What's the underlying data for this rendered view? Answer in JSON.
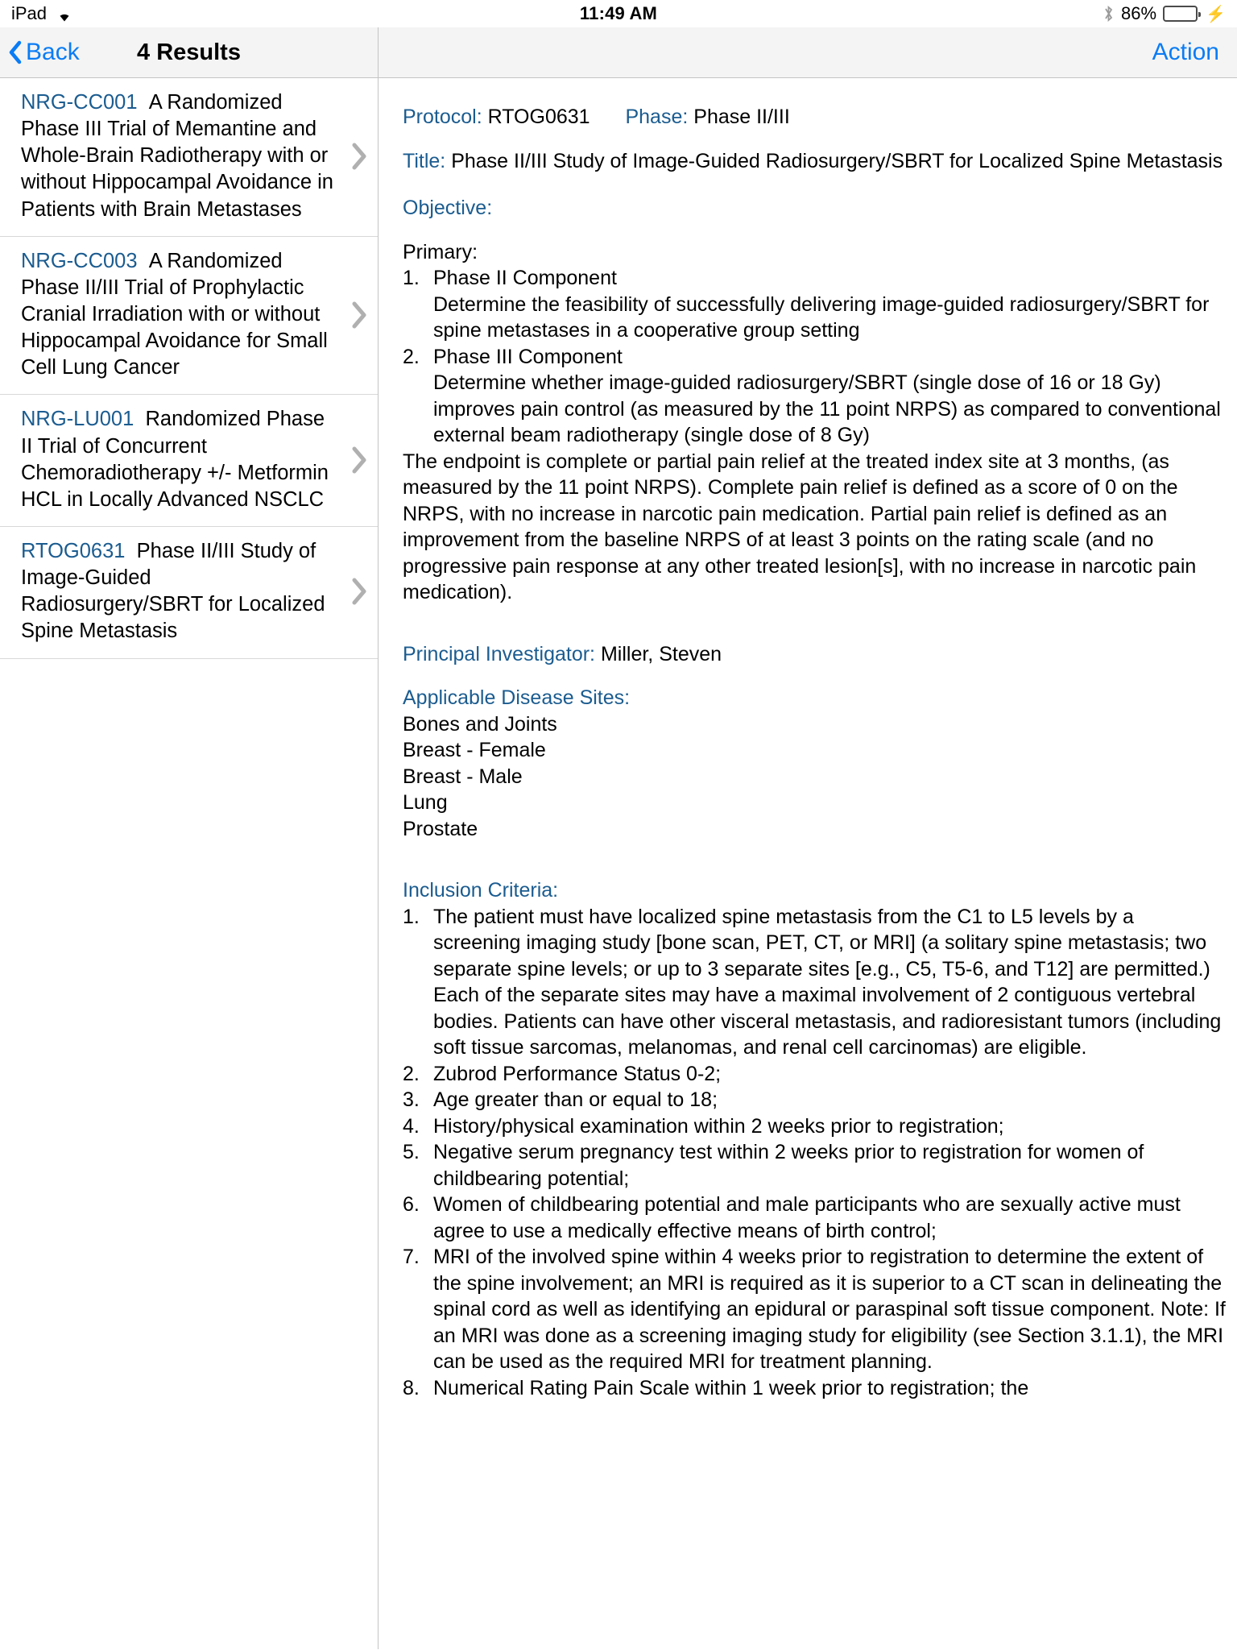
{
  "status_bar": {
    "device": "iPad",
    "wifi_icon": "wifi-icon",
    "time": "11:49 AM",
    "bluetooth_icon": "bluetooth-icon",
    "battery_percent": "86%",
    "battery_level": 86,
    "charging": true,
    "battery_color": "#4cd662"
  },
  "nav": {
    "back_label": "Back",
    "title": "4 Results",
    "action_label": "Action",
    "accent_color": "#0a7cf5"
  },
  "results": {
    "items": [
      {
        "code": "NRG-CC001",
        "title": "A Randomized Phase III Trial of Memantine and Whole-Brain Radiotherapy with or without Hippocampal Avoidance in Patients with Brain Metastases"
      },
      {
        "code": "NRG-CC003",
        "title": "A Randomized Phase II/III Trial of Prophylactic Cranial Irradiation with or without Hippocampal Avoidance for Small Cell Lung Cancer"
      },
      {
        "code": "NRG-LU001",
        "title": "Randomized Phase II Trial of Concurrent Chemoradiotherapy +/- Metformin HCL in Locally Advanced NSCLC"
      },
      {
        "code": "RTOG0631",
        "title": "Phase II/III Study of Image-Guided Radiosurgery/SBRT for Localized Spine Metastasis"
      }
    ],
    "chevron_icon": "chevron-right-icon",
    "code_color": "#1b5c90"
  },
  "detail": {
    "protocol_label": "Protocol:",
    "protocol_value": "RTOG0631",
    "phase_label": "Phase:",
    "phase_value": "Phase II/III",
    "title_label": "Title:",
    "title_value": "Phase II/III Study of Image-Guided Radiosurgery/SBRT for Localized Spine Metastasis",
    "objective_label": "Objective:",
    "primary_label": "Primary:",
    "objectives": [
      {
        "num": "1.",
        "head": "Phase II Component",
        "body": "Determine the feasibility of successfully delivering image-guided radiosurgery/SBRT for spine metastases in a cooperative group setting"
      },
      {
        "num": "2.",
        "head": "Phase III Component",
        "body": "Determine whether image-guided radiosurgery/SBRT (single dose of 16 or 18 Gy) improves pain control (as measured by the 11 point NRPS) as compared to conventional external beam radiotherapy (single dose of 8 Gy)"
      }
    ],
    "endpoint_paragraph": "The endpoint is complete or partial pain relief at the treated index site at 3 months, (as measured by the 11 point NRPS). Complete pain relief is defined as a score of 0 on the NRPS, with no increase in narcotic pain medication. Partial pain relief is defined as an improvement from the baseline NRPS of at least 3 points on the rating scale (and no progressive pain response at any other treated lesion[s], with no increase in narcotic pain medication).",
    "pi_label": "Principal Investigator:",
    "pi_value": "Miller, Steven",
    "disease_sites_label": "Applicable Disease Sites:",
    "disease_sites": [
      "Bones and Joints",
      "Breast - Female",
      "Breast - Male",
      "Lung",
      "Prostate"
    ],
    "inclusion_label": "Inclusion Criteria:",
    "inclusion_criteria": [
      {
        "num": "1.",
        "text": "The patient must have localized spine metastasis from the C1 to L5 levels by a screening imaging study [bone scan, PET, CT, or MRI] (a solitary spine metastasis; two separate spine levels; or up to 3 separate sites [e.g., C5, T5-6, and T12] are permitted.) Each of the separate sites may have a maximal involvement of 2 contiguous vertebral bodies. Patients can have other visceral metastasis, and radioresistant tumors (including soft tissue sarcomas, melanomas, and renal cell carcinomas) are eligible."
      },
      {
        "num": "2.",
        "text": "Zubrod Performance Status 0-2;"
      },
      {
        "num": "3.",
        "text": "Age greater than or equal to 18;"
      },
      {
        "num": "4.",
        "text": "History/physical examination within 2 weeks prior to registration;"
      },
      {
        "num": "5.",
        "text": "Negative serum pregnancy test within 2 weeks prior to registration for women of childbearing potential;"
      },
      {
        "num": "6.",
        "text": "Women of childbearing potential and male participants who are sexually active must agree to use a medically effective means of birth control;"
      },
      {
        "num": "7.",
        "text": "MRI of the involved spine within 4 weeks prior to registration to determine the extent of the spine involvement; an MRI is required as it is superior to a CT scan in delineating the spinal cord as well as identifying an epidural or paraspinal soft tissue component. Note: If an MRI was done as a screening imaging study for eligibility (see Section 3.1.1), the MRI can be used as the required MRI for treatment planning."
      },
      {
        "num": "8.",
        "text": "Numerical Rating Pain Scale within 1 week prior to registration; the"
      }
    ],
    "label_color": "#1b5c90"
  }
}
